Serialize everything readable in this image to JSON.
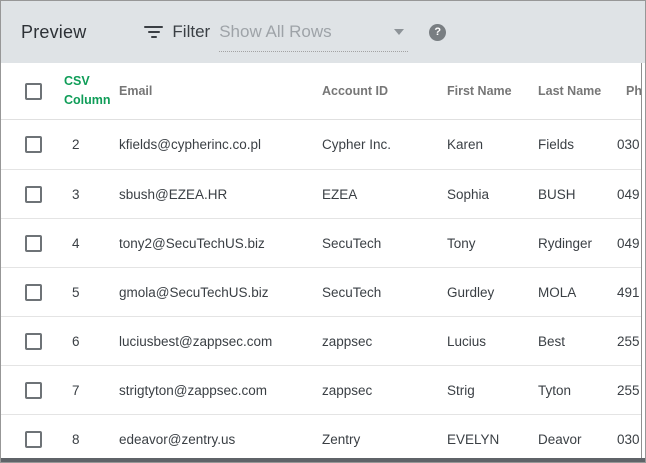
{
  "topbar": {
    "title": "Preview",
    "filter_label": "Filter",
    "filter_value": "Show All Rows",
    "help_glyph": "?"
  },
  "table": {
    "headers": {
      "csv": "CSV Column",
      "email": "Email",
      "account": "Account ID",
      "first": "First Name",
      "last": "Last Name",
      "phone": "Phone"
    },
    "rows": [
      {
        "csv": "2",
        "email": "kfields@cypherinc.co.pl",
        "account": "Cypher Inc.",
        "first": "Karen",
        "last": "Fields",
        "phone": "030"
      },
      {
        "csv": "3",
        "email": "sbush@EZEA.HR",
        "account": "EZEA",
        "first": "Sophia",
        "last": "BUSH",
        "phone": "049"
      },
      {
        "csv": "4",
        "email": "tony2@SecuTechUS.biz",
        "account": "SecuTech",
        "first": "Tony",
        "last": "Rydinger",
        "phone": "049"
      },
      {
        "csv": "5",
        "email": "gmola@SecuTechUS.biz",
        "account": "SecuTech",
        "first": "Gurdley",
        "last": "MOLA",
        "phone": "491"
      },
      {
        "csv": "6",
        "email": "luciusbest@zappsec.com",
        "account": "zappsec",
        "first": "Lucius",
        "last": "Best",
        "phone": "255"
      },
      {
        "csv": "7",
        "email": "strigtyton@zappsec.com",
        "account": "zappsec",
        "first": "Strig",
        "last": "Tyton",
        "phone": "255"
      },
      {
        "csv": "8",
        "email": "edeavor@zentry.us",
        "account": "Zentry",
        "first": "EVELYN",
        "last": "Deavor",
        "phone": "030"
      }
    ]
  },
  "colors": {
    "topbar_bg": "#dfe3e6",
    "accent_green": "#0f9d58",
    "bottom_bar": "#5f6368"
  }
}
